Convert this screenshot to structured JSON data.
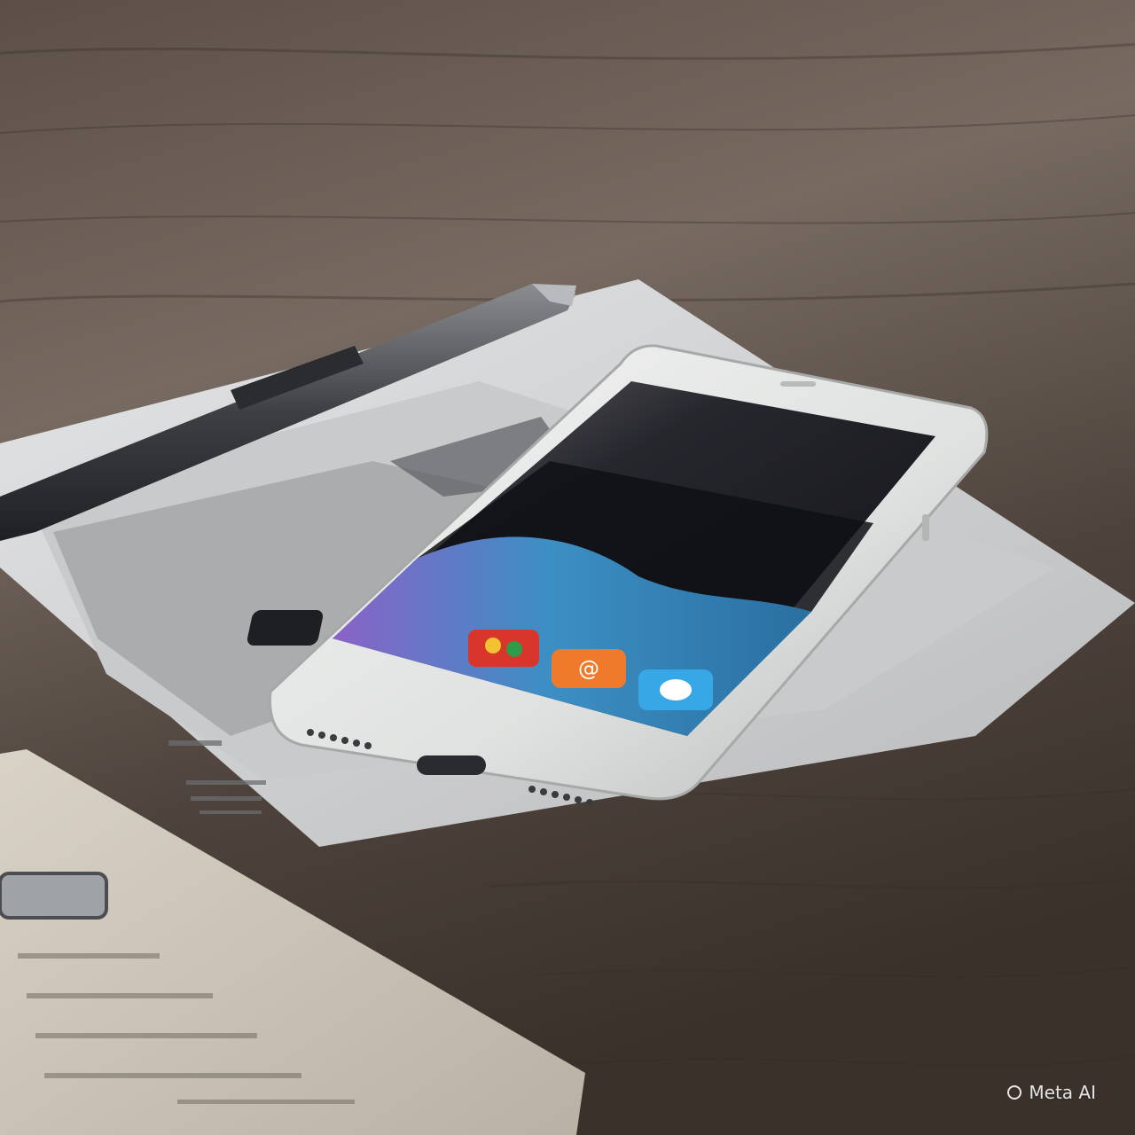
{
  "scene": {
    "description_colors": {
      "table_dark": "#3b322c",
      "table_mid": "#6a5c52",
      "table_light": "#8c7f76",
      "paper": "#d9dadb",
      "phone_body": "#e9ebea",
      "screen_dark": "#1d1f27",
      "wallpaper_blue": "#2f7fb0",
      "wallpaper_purple": "#7a5bb8"
    },
    "phone": {
      "dock_icons": [
        {
          "name": "dark-app-icon",
          "color": "#1e1f22"
        },
        {
          "name": "colorful-app-icon",
          "color": "#d8352b"
        },
        {
          "name": "orange-at-app-icon",
          "color": "#f07a2c"
        },
        {
          "name": "blue-chat-app-icon",
          "color": "#37a7e6"
        }
      ]
    }
  },
  "watermark": {
    "label": "Meta AI"
  }
}
